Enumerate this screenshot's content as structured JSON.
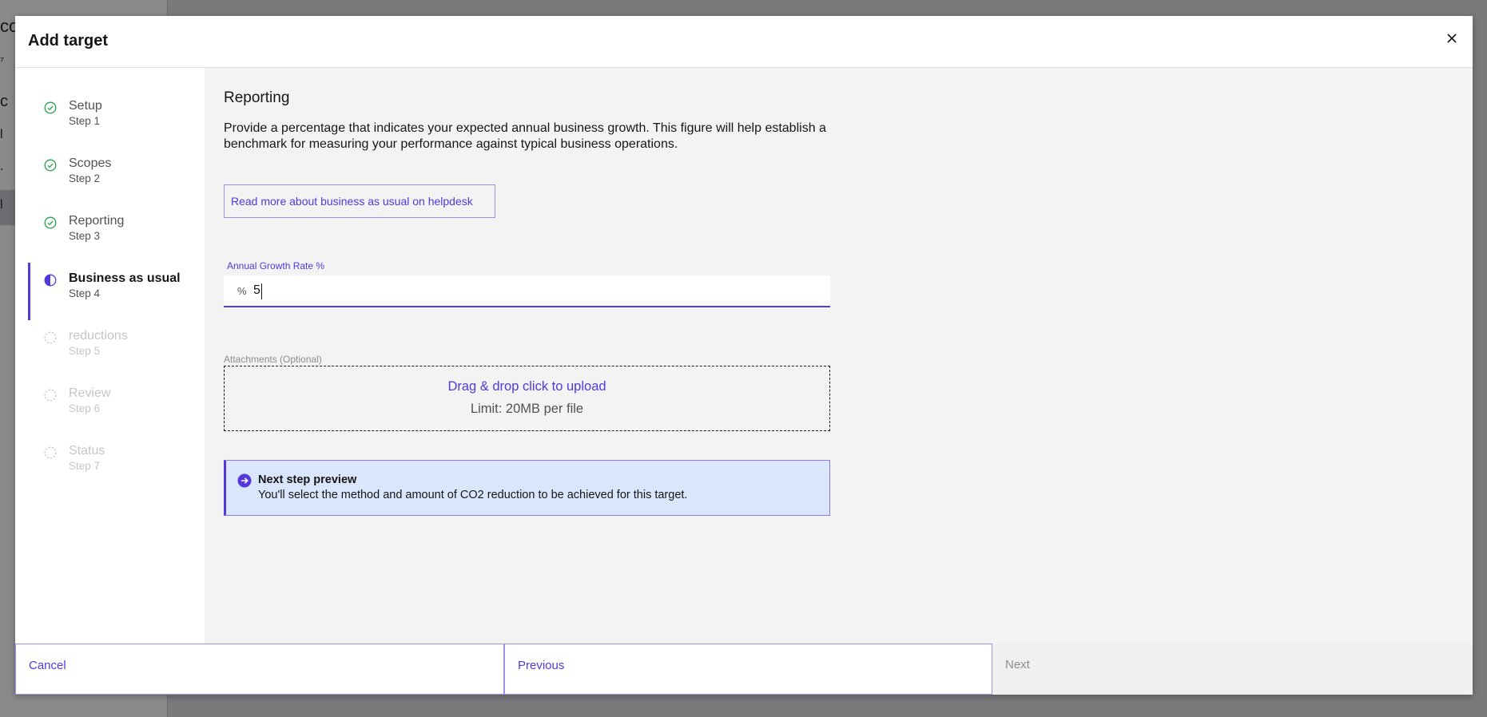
{
  "background": {
    "glyphs": [
      "co",
      "⁷",
      "c",
      "l",
      ".",
      "l"
    ]
  },
  "modal": {
    "title": "Add target",
    "close_icon": "close-icon"
  },
  "steps": [
    {
      "label": "Setup",
      "sub": "Step 1",
      "state": "complete"
    },
    {
      "label": "Scopes",
      "sub": "Step 2",
      "state": "complete"
    },
    {
      "label": "Reporting",
      "sub": "Step 3",
      "state": "complete"
    },
    {
      "label": "Business as usual",
      "sub": "Step 4",
      "state": "current"
    },
    {
      "label": "reductions",
      "sub": "Step 5",
      "state": "disabled"
    },
    {
      "label": "Review",
      "sub": "Step 6",
      "state": "disabled"
    },
    {
      "label": "Status",
      "sub": "Step 7",
      "state": "disabled"
    }
  ],
  "content": {
    "title": "Reporting",
    "description": "Provide a percentage that indicates your expected annual business growth. This figure will help establish a benchmark for measuring your performance against typical business operations.",
    "help_link": "Read more about business as usual on helpdesk",
    "growth_field": {
      "label": "Annual Growth Rate %",
      "prefix": "%",
      "value": "5"
    },
    "attachments": {
      "label": "Attachments (Optional)",
      "primary": "Drag & drop click to upload",
      "secondary": "Limit: 20MB per file"
    },
    "notice": {
      "title": "Next step preview",
      "body": "You'll select the method and amount of CO2 reduction to be achieved for this target."
    }
  },
  "footer": {
    "cancel": "Cancel",
    "previous": "Previous",
    "next": "Next"
  },
  "colors": {
    "accent": "#5438dc",
    "success": "#24a148",
    "overlay": "#7a7a7d",
    "notice_bg": "#d9e6fb"
  }
}
